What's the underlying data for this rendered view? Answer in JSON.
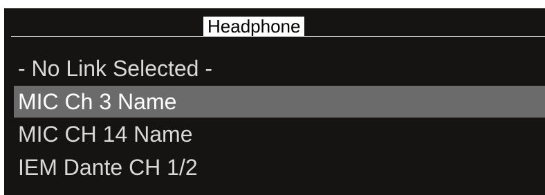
{
  "menu": {
    "title": "Headphone",
    "items": [
      {
        "label": "- No Link Selected -",
        "selected": false
      },
      {
        "label": "MIC Ch 3 Name",
        "selected": true
      },
      {
        "label": "MIC CH 14 Name",
        "selected": false
      },
      {
        "label": "IEM Dante CH 1/2",
        "selected": false
      }
    ]
  },
  "colors": {
    "background": "#151412",
    "selected_row": "#6b6b6b",
    "title_bg": "#ffffff",
    "text": "#d9d9d9"
  }
}
